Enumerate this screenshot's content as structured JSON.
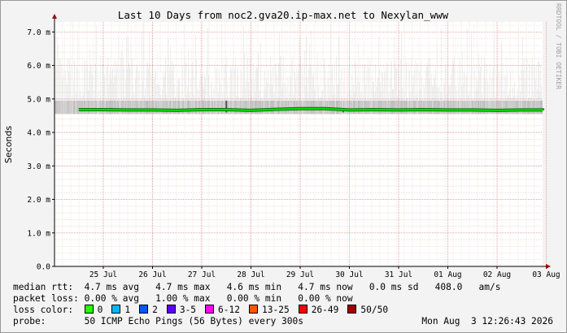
{
  "chart_data": {
    "type": "line",
    "title": "Last 10 Days from noc2.gva20.ip-max.net to Nexylan_www",
    "ylabel": "Seconds",
    "ylim": [
      0,
      7.3
    ],
    "y_ticks": [
      "0.0",
      "1.0 m",
      "2.0 m",
      "3.0 m",
      "4.0 m",
      "5.0 m",
      "6.0 m",
      "7.0 m"
    ],
    "y_tick_values": [
      0,
      1,
      2,
      3,
      4,
      5,
      6,
      7
    ],
    "x_ticks": [
      "25 Jul",
      "26 Jul",
      "27 Jul",
      "28 Jul",
      "29 Jul",
      "30 Jul",
      "31 Jul",
      "01 Aug",
      "02 Aug",
      "03 Aug"
    ],
    "grid": true,
    "series": [
      {
        "name": "median rtt",
        "color": "#00dd00",
        "x": [
          "24 Jul 12:00",
          "25 Jul 00:00",
          "25 Jul 12:00",
          "26 Jul 00:00",
          "26 Jul 12:00",
          "27 Jul 00:00",
          "27 Jul 12:00",
          "28 Jul 00:00",
          "28 Jul 12:00",
          "29 Jul 00:00",
          "29 Jul 12:00",
          "30 Jul 00:00",
          "30 Jul 12:00",
          "31 Jul 00:00",
          "31 Jul 12:00",
          "01 Aug 00:00",
          "01 Aug 12:00",
          "02 Aug 00:00",
          "02 Aug 12:00",
          "03 Aug 00:00",
          "03 Aug 12:00"
        ],
        "values": [
          4.68,
          4.68,
          4.67,
          4.67,
          4.66,
          4.68,
          4.68,
          4.66,
          4.69,
          4.71,
          4.71,
          4.67,
          4.68,
          4.67,
          4.68,
          4.67,
          4.67,
          4.66,
          4.67,
          4.67,
          4.66
        ]
      }
    ],
    "smoke_band": {
      "color": "#7a7a7a",
      "low": 4.55,
      "high_max": 7.3
    },
    "spikes": [
      {
        "x": "27 Jul 12:00",
        "value": 4.95,
        "color": "#555555"
      },
      {
        "x": "29 Jul 21:00",
        "value": 4.72,
        "color": "#1f6fe0"
      }
    ]
  },
  "watermark": "RRDTOOL / TOBI OETIKER",
  "stats": {
    "median_rtt_label": "median rtt:",
    "median_rtt_values": "4.7 ms avg   4.7 ms max   4.6 ms min   4.7 ms now   0.0 ms sd   408.0   am/s",
    "packet_loss_label": "packet loss:",
    "packet_loss_values": "0.00 % avg   1.00 % max   0.00 % min   0.00 % now"
  },
  "loss_color": {
    "label": "loss color:",
    "items": [
      {
        "label": "0",
        "color": "#26ff00"
      },
      {
        "label": "1",
        "color": "#00b8ff"
      },
      {
        "label": "2",
        "color": "#0059ff"
      },
      {
        "label": "3-5",
        "color": "#5e00ff"
      },
      {
        "label": "6-12",
        "color": "#ff00f2"
      },
      {
        "label": "13-25",
        "color": "#ff5500"
      },
      {
        "label": "26-49",
        "color": "#ff0000"
      },
      {
        "label": "50/50",
        "color": "#a00000"
      }
    ]
  },
  "probe": {
    "label": "probe:",
    "value": "50 ICMP Echo Pings (56 Bytes) every 300s",
    "timestamp": "Mon Aug  3 12:26:43 2026"
  }
}
